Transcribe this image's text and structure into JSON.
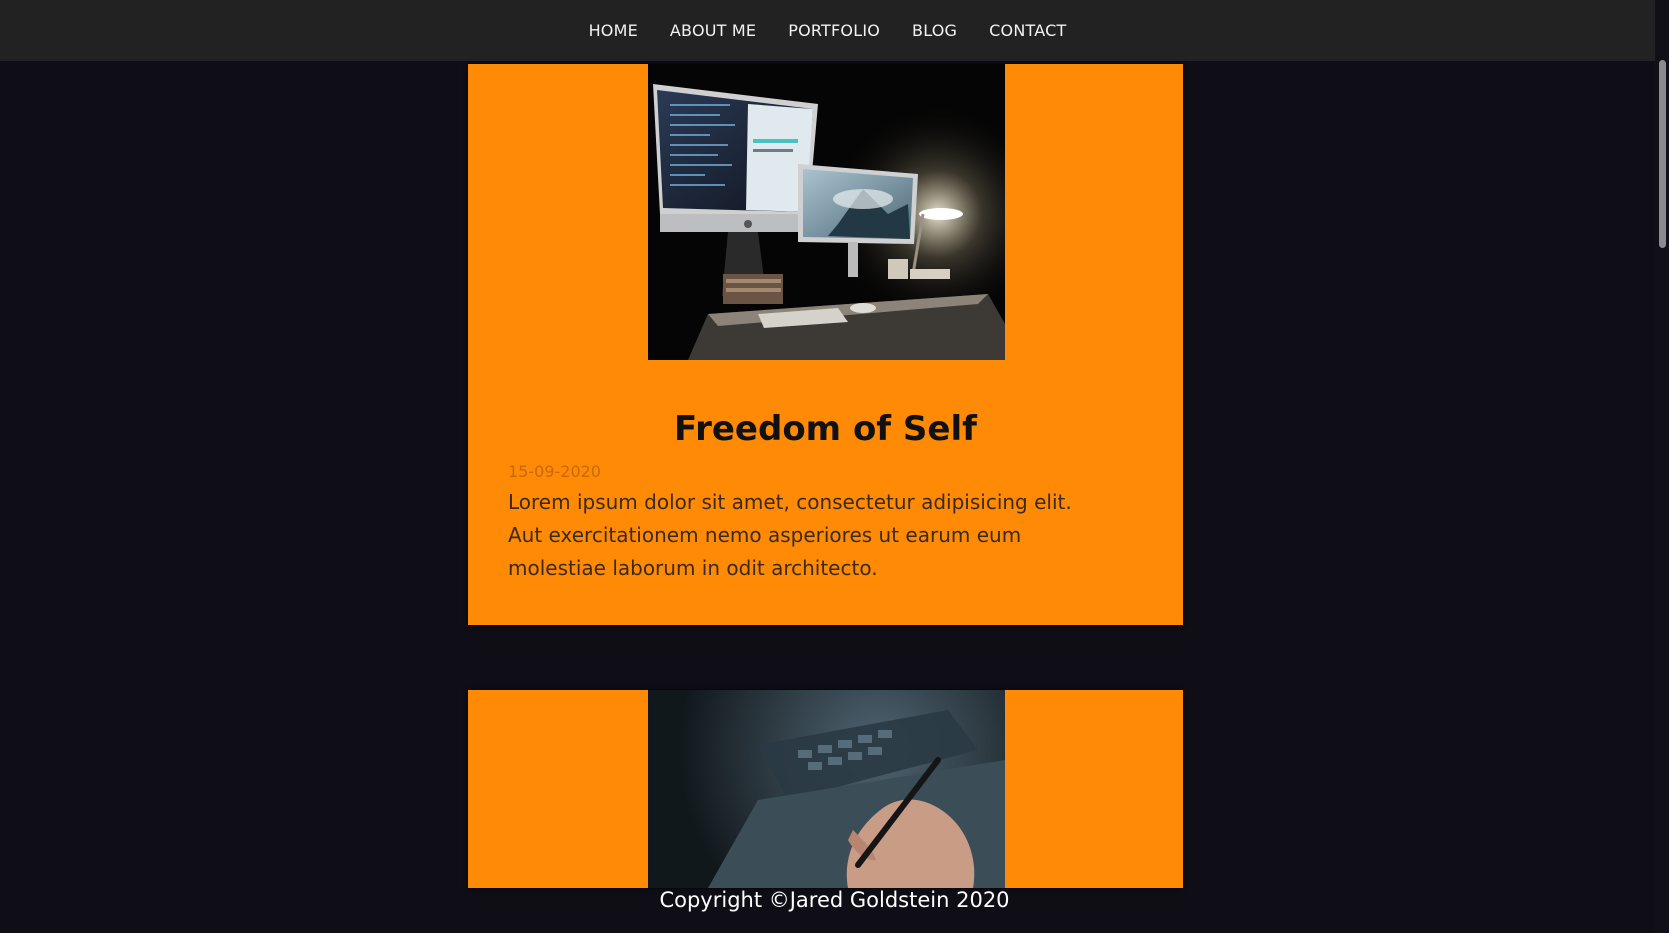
{
  "nav": {
    "items": [
      {
        "label": "HOME"
      },
      {
        "label": "ABOUT ME"
      },
      {
        "label": "PORTFOLIO"
      },
      {
        "label": "BLOG"
      },
      {
        "label": "CONTACT"
      }
    ]
  },
  "posts": [
    {
      "title": "Freedom of Self",
      "date": "15-09-2020",
      "excerpt": "Lorem ipsum dolor sit amet, consectetur adipisicing elit. Aut exercitationem nemo asperiores ut earum eum molestiae laborum in odit architecto.",
      "image": "desk-computer-setup-photo"
    },
    {
      "image": "hand-drawing-tablet-photo"
    }
  ],
  "footer": {
    "text": "Copyright ©Jared Goldstein 2020"
  },
  "colors": {
    "background": "#0f0e17",
    "navbar": "#222222",
    "card": "#ff8a05",
    "title": "#111111"
  }
}
